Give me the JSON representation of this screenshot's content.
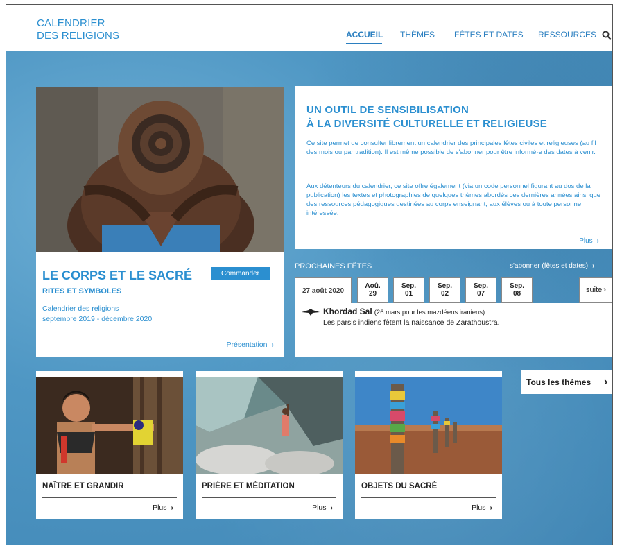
{
  "header": {
    "logo_line1": "CALENDRIER",
    "logo_line2": "DES RELIGIONS",
    "nav": [
      "ACCUEIL",
      "THÈMES",
      "FÊTES ET DATES",
      "RESSOURCES"
    ],
    "active_nav": "ACCUEIL",
    "search_icon": "search-icon"
  },
  "hero": {
    "title": "LE CORPS ET LE SACRÉ",
    "subtitle": "RITES ET SYMBOLES",
    "calendar_line1": "Calendrier des religions",
    "calendar_line2": "septembre 2019 - décembre 2020",
    "order_button": "Commander",
    "link": "Présentation"
  },
  "intro": {
    "title_line1": "UN OUTIL DE SENSIBILISATION",
    "title_line2": "À LA DIVERSITÉ CULTURELLE ET RELIGIEUSE",
    "para1": "Ce site permet de consulter librement un calendrier des principales fêtes civiles et religieuses (au fil des mois ou par tradition). Il est même possible de s'abonner pour être informé·e des dates à venir.",
    "para2": "Aux détenteurs du calendrier, ce site offre également (via un code personnel figurant au dos de la publication) les textes et photographies de quelques thèmes abordés ces dernières années ainsi que des ressources pédagogiques destinées au corps enseignant, aux élèves ou à toute personne intéressée.",
    "link": "Plus"
  },
  "fetes": {
    "heading": "PROCHAINES FÊTES",
    "subscribe": "s'abonner (fêtes et dates)",
    "active_tab": "27 août 2020",
    "tabs": [
      {
        "month": "Aoû.",
        "day": "29"
      },
      {
        "month": "Sep.",
        "day": "01"
      },
      {
        "month": "Sep.",
        "day": "02"
      },
      {
        "month": "Sep.",
        "day": "07"
      },
      {
        "month": "Sep.",
        "day": "08"
      }
    ],
    "next": "suite",
    "event_name": "Khordad Sal",
    "event_note": "(26 mars pour les mazdéens iraniens)",
    "event_desc": "Les parsis indiens fêtent la naissance de Zarathoustra.",
    "event_icon": "faravahar-icon"
  },
  "themes": {
    "all_button": "Tous les thèmes",
    "items": [
      {
        "title": "NAÎTRE ET GRANDIR",
        "link": "Plus"
      },
      {
        "title": "PRIÈRE ET MÉDITATION",
        "link": "Plus"
      },
      {
        "title": "OBJETS DU SACRÉ",
        "link": "Plus"
      }
    ]
  },
  "colors": {
    "accent": "#2b8fd0",
    "background": "#4f97c4"
  }
}
